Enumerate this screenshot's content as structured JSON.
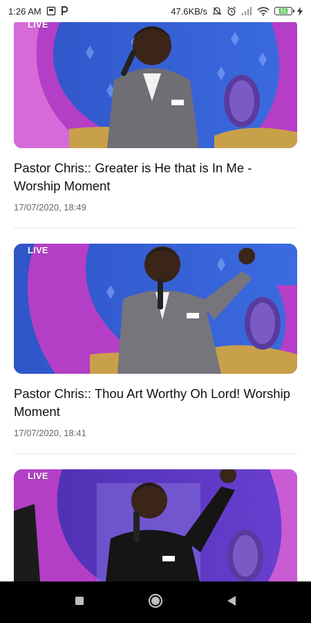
{
  "status_bar": {
    "time": "1:26 AM",
    "speed": "47.6KB/s",
    "battery_level": "55",
    "icons": [
      "screenshot-icon",
      "p-icon",
      "mute-icon",
      "alarm-icon",
      "signal-icon",
      "wifi-icon",
      "battery-icon",
      "charging-icon"
    ]
  },
  "videos": [
    {
      "badge": "LIVE",
      "title": "Pastor Chris:: Greater is He that is In Me - Worship Moment",
      "date": "17/07/2020, 18:49"
    },
    {
      "badge": "LIVE",
      "title": "Pastor Chris:: Thou Art Worthy Oh Lord! Worship Moment",
      "date": "17/07/2020, 18:41"
    },
    {
      "badge": "LIVE"
    }
  ],
  "navigation": {
    "icons": [
      "recents-icon",
      "home-icon",
      "back-icon"
    ]
  },
  "colors": {
    "stage_blue": "#2f55c8",
    "stage_purple": "#b43fc6",
    "battery_green": "#3dbb3d"
  }
}
